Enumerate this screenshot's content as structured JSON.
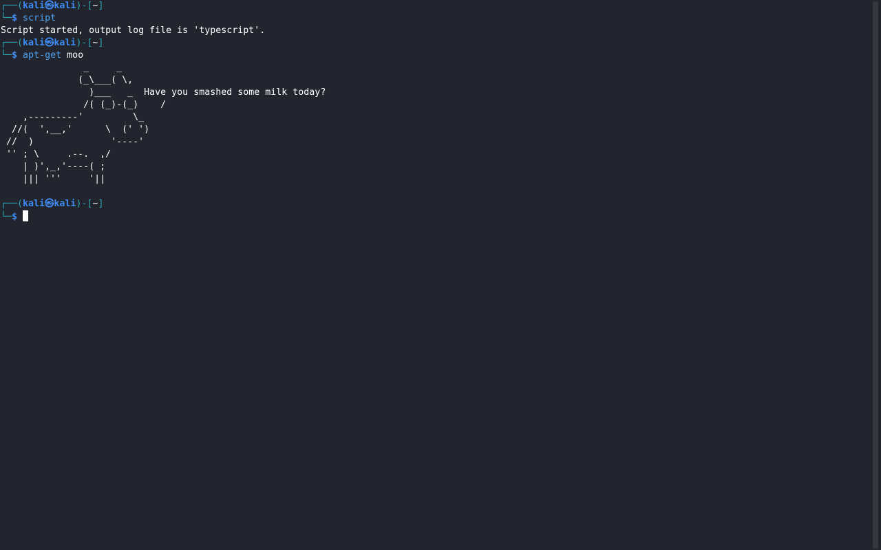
{
  "prompt": {
    "open": "┌──(",
    "user": "kali",
    "at_symbol": "㉿",
    "host": "kali",
    "mid": ")-[",
    "dir": "~",
    "close": "]",
    "second_line": "└─",
    "dollar": "$"
  },
  "commands": [
    {
      "cmd": "script",
      "arg": ""
    },
    {
      "cmd": "apt-get",
      "arg": "moo"
    }
  ],
  "output": {
    "script_started": "Script started, output log file is 'typescript'."
  },
  "cow_art": [
    "               _     _",
    "              (_\\___( \\,",
    "                )___   _  Have you smashed some milk today?",
    "               /( (_)-(_)    /",
    "    ,---------'         \\_",
    "  //(  ',__,'      \\  (' ')",
    " //  )              '----'",
    " '' ; \\     .--.  ,/",
    "    | )',_,'----( ;",
    "    ||| '''     '||",
    ""
  ],
  "colors": {
    "background": "#23252e",
    "frame": "#2aa7b3",
    "user_host": "#3f8ef5",
    "command": "#4aa2f0",
    "text": "#ffffff"
  }
}
